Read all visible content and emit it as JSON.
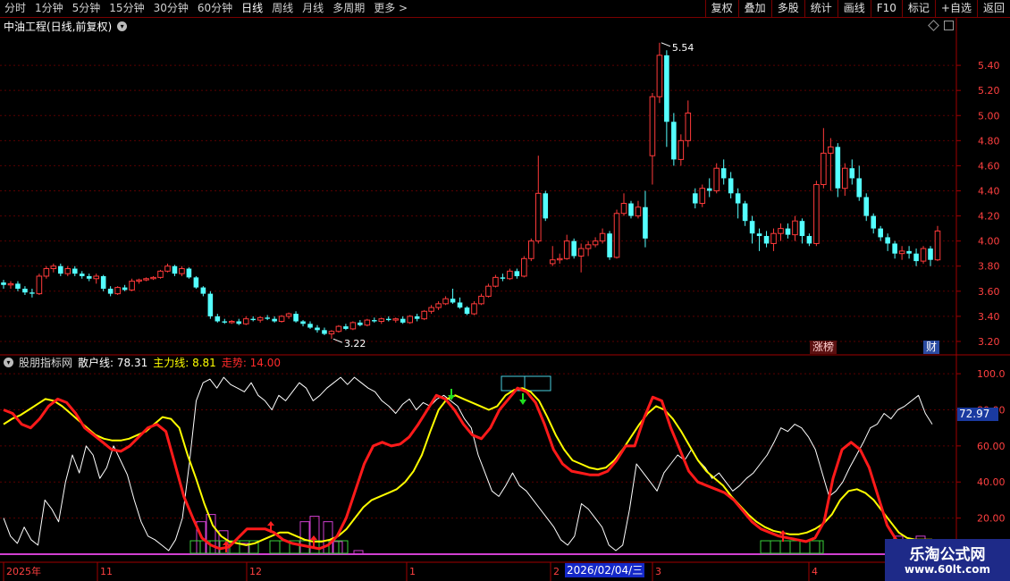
{
  "toolbar": {
    "periods": [
      "分时",
      "1分钟",
      "5分钟",
      "15分钟",
      "30分钟",
      "60分钟",
      "日线",
      "周线",
      "月线",
      "多周期",
      "更多 >"
    ],
    "active_period": "日线",
    "buttons": [
      "复权",
      "叠加",
      "多股",
      "统计",
      "画线",
      "F10",
      "标记",
      "+自选",
      "返回"
    ]
  },
  "header": {
    "stock": "中油工程(日线,前复权)"
  },
  "indicator": {
    "name": "股朋指标网",
    "retail": "散户线: 78.31",
    "main": "主力线: 8.81",
    "trend": "走势: 14.00",
    "current_value": "72.97"
  },
  "badges": {
    "zb": "涨榜",
    "cai": "财"
  },
  "date_box": "2026/02/04/三",
  "watermark": {
    "title": "乐淘公式网",
    "url": "www.60lt.com"
  },
  "colors": {
    "up": "#ff3a3a",
    "down": "#54ffff",
    "yellow": "#ffff00",
    "red_line": "#ff1a1a",
    "magenta": "#d040d0",
    "green": "#3ad23a",
    "grid": "#5a0000"
  },
  "chart_data": [
    {
      "type": "candlestick",
      "title": "中油工程(日线,前复权)",
      "ylim": [
        3.1,
        5.65
      ],
      "y_ticks": [
        "5.40",
        "5.20",
        "5.00",
        "4.80",
        "4.60",
        "4.40",
        "4.20",
        "4.00",
        "3.80",
        "3.60",
        "3.40",
        "3.20"
      ],
      "x_ticks": [
        "2025年",
        "11",
        "12",
        "1",
        "2",
        "3",
        "4"
      ],
      "annotations": {
        "high": "5.54",
        "low": "3.22"
      },
      "ohlc": [
        [
          3.67,
          3.69,
          3.62,
          3.65
        ],
        [
          3.65,
          3.68,
          3.62,
          3.66
        ],
        [
          3.66,
          3.68,
          3.6,
          3.62
        ],
        [
          3.62,
          3.64,
          3.57,
          3.59
        ],
        [
          3.59,
          3.62,
          3.55,
          3.58
        ],
        [
          3.58,
          3.74,
          3.57,
          3.72
        ],
        [
          3.72,
          3.8,
          3.7,
          3.78
        ],
        [
          3.78,
          3.82,
          3.75,
          3.8
        ],
        [
          3.8,
          3.82,
          3.72,
          3.74
        ],
        [
          3.74,
          3.8,
          3.72,
          3.78
        ],
        [
          3.78,
          3.8,
          3.72,
          3.74
        ],
        [
          3.74,
          3.76,
          3.7,
          3.72
        ],
        [
          3.72,
          3.74,
          3.68,
          3.7
        ],
        [
          3.7,
          3.74,
          3.66,
          3.72
        ],
        [
          3.72,
          3.73,
          3.6,
          3.62
        ],
        [
          3.62,
          3.64,
          3.56,
          3.58
        ],
        [
          3.58,
          3.64,
          3.57,
          3.63
        ],
        [
          3.63,
          3.65,
          3.6,
          3.61
        ],
        [
          3.61,
          3.7,
          3.6,
          3.68
        ],
        [
          3.68,
          3.7,
          3.66,
          3.69
        ],
        [
          3.69,
          3.71,
          3.68,
          3.7
        ],
        [
          3.7,
          3.72,
          3.69,
          3.71
        ],
        [
          3.71,
          3.77,
          3.7,
          3.76
        ],
        [
          3.76,
          3.82,
          3.75,
          3.8
        ],
        [
          3.8,
          3.81,
          3.72,
          3.74
        ],
        [
          3.74,
          3.8,
          3.72,
          3.78
        ],
        [
          3.78,
          3.79,
          3.7,
          3.71
        ],
        [
          3.71,
          3.72,
          3.62,
          3.63
        ],
        [
          3.63,
          3.64,
          3.56,
          3.58
        ],
        [
          3.58,
          3.6,
          3.38,
          3.4
        ],
        [
          3.4,
          3.42,
          3.35,
          3.36
        ],
        [
          3.36,
          3.38,
          3.34,
          3.35
        ],
        [
          3.35,
          3.37,
          3.34,
          3.36
        ],
        [
          3.36,
          3.38,
          3.33,
          3.34
        ],
        [
          3.34,
          3.4,
          3.33,
          3.38
        ],
        [
          3.38,
          3.4,
          3.36,
          3.37
        ],
        [
          3.37,
          3.4,
          3.35,
          3.39
        ],
        [
          3.39,
          3.41,
          3.37,
          3.38
        ],
        [
          3.38,
          3.4,
          3.35,
          3.36
        ],
        [
          3.36,
          3.41,
          3.35,
          3.4
        ],
        [
          3.4,
          3.43,
          3.38,
          3.42
        ],
        [
          3.42,
          3.44,
          3.35,
          3.36
        ],
        [
          3.36,
          3.37,
          3.32,
          3.34
        ],
        [
          3.34,
          3.36,
          3.3,
          3.31
        ],
        [
          3.31,
          3.33,
          3.27,
          3.29
        ],
        [
          3.29,
          3.31,
          3.25,
          3.26
        ],
        [
          3.26,
          3.29,
          3.22,
          3.28
        ],
        [
          3.28,
          3.33,
          3.27,
          3.32
        ],
        [
          3.32,
          3.34,
          3.29,
          3.3
        ],
        [
          3.3,
          3.36,
          3.29,
          3.35
        ],
        [
          3.35,
          3.37,
          3.32,
          3.33
        ],
        [
          3.33,
          3.38,
          3.32,
          3.37
        ],
        [
          3.37,
          3.39,
          3.35,
          3.36
        ],
        [
          3.36,
          3.39,
          3.34,
          3.38
        ],
        [
          3.38,
          3.4,
          3.36,
          3.37
        ],
        [
          3.37,
          3.39,
          3.35,
          3.38
        ],
        [
          3.38,
          3.4,
          3.34,
          3.35
        ],
        [
          3.35,
          3.41,
          3.34,
          3.4
        ],
        [
          3.4,
          3.42,
          3.36,
          3.38
        ],
        [
          3.38,
          3.45,
          3.37,
          3.44
        ],
        [
          3.44,
          3.49,
          3.42,
          3.47
        ],
        [
          3.47,
          3.52,
          3.45,
          3.5
        ],
        [
          3.5,
          3.56,
          3.49,
          3.54
        ],
        [
          3.54,
          3.62,
          3.5,
          3.51
        ],
        [
          3.51,
          3.55,
          3.46,
          3.47
        ],
        [
          3.47,
          3.48,
          3.41,
          3.42
        ],
        [
          3.42,
          3.52,
          3.41,
          3.5
        ],
        [
          3.5,
          3.58,
          3.49,
          3.56
        ],
        [
          3.56,
          3.66,
          3.55,
          3.64
        ],
        [
          3.64,
          3.73,
          3.63,
          3.71
        ],
        [
          3.71,
          3.74,
          3.68,
          3.7
        ],
        [
          3.7,
          3.78,
          3.69,
          3.76
        ],
        [
          3.76,
          3.78,
          3.7,
          3.72
        ],
        [
          3.72,
          3.88,
          3.71,
          3.86
        ],
        [
          3.86,
          4.02,
          3.84,
          4.0
        ],
        [
          4.0,
          4.68,
          3.98,
          4.38
        ],
        [
          4.38,
          4.4,
          4.16,
          4.18
        ],
        [
          3.82,
          3.96,
          3.8,
          3.85
        ],
        [
          3.85,
          3.9,
          3.82,
          3.86
        ],
        [
          3.86,
          4.05,
          3.85,
          4.0
        ],
        [
          4.0,
          4.02,
          3.86,
          3.88
        ],
        [
          3.88,
          3.98,
          3.75,
          3.94
        ],
        [
          3.94,
          4.0,
          3.88,
          3.97
        ],
        [
          3.97,
          4.03,
          3.95,
          4.0
        ],
        [
          4.0,
          4.1,
          3.98,
          4.06
        ],
        [
          4.06,
          4.08,
          3.85,
          3.87
        ],
        [
          3.87,
          4.25,
          3.86,
          4.22
        ],
        [
          4.22,
          4.38,
          4.2,
          4.3
        ],
        [
          4.3,
          4.32,
          4.18,
          4.2
        ],
        [
          4.2,
          4.32,
          4.18,
          4.27
        ],
        [
          4.27,
          4.4,
          3.95,
          4.02
        ],
        [
          4.68,
          5.18,
          4.45,
          5.15
        ],
        [
          5.15,
          5.58,
          5.1,
          5.48
        ],
        [
          5.48,
          5.52,
          4.75,
          4.95
        ],
        [
          4.95,
          5.02,
          4.6,
          4.65
        ],
        [
          4.65,
          4.85,
          4.6,
          4.8
        ],
        [
          4.8,
          5.12,
          4.75,
          5.02
        ],
        [
          4.38,
          4.42,
          4.26,
          4.3
        ],
        [
          4.3,
          4.45,
          4.27,
          4.42
        ],
        [
          4.42,
          4.5,
          4.35,
          4.4
        ],
        [
          4.4,
          4.62,
          4.38,
          4.58
        ],
        [
          4.58,
          4.65,
          4.45,
          4.5
        ],
        [
          4.5,
          4.55,
          4.34,
          4.38
        ],
        [
          4.38,
          4.42,
          4.18,
          4.3
        ],
        [
          4.3,
          4.32,
          4.12,
          4.16
        ],
        [
          4.16,
          4.2,
          3.98,
          4.06
        ],
        [
          4.06,
          4.1,
          3.92,
          4.04
        ],
        [
          4.04,
          4.08,
          3.95,
          3.98
        ],
        [
          3.98,
          4.1,
          3.92,
          4.06
        ],
        [
          4.06,
          4.14,
          4.0,
          4.1
        ],
        [
          4.1,
          4.14,
          4.02,
          4.05
        ],
        [
          4.05,
          4.2,
          4.0,
          4.16
        ],
        [
          4.16,
          4.18,
          3.98,
          4.04
        ],
        [
          4.04,
          4.06,
          3.96,
          3.98
        ],
        [
          3.98,
          4.48,
          3.96,
          4.45
        ],
        [
          4.45,
          4.9,
          4.42,
          4.7
        ],
        [
          4.7,
          4.82,
          4.4,
          4.75
        ],
        [
          4.75,
          4.78,
          4.35,
          4.42
        ],
        [
          4.42,
          4.62,
          4.36,
          4.58
        ],
        [
          4.58,
          4.65,
          4.45,
          4.5
        ],
        [
          4.5,
          4.6,
          4.32,
          4.35
        ],
        [
          4.35,
          4.38,
          4.16,
          4.2
        ],
        [
          4.2,
          4.22,
          4.06,
          4.1
        ],
        [
          4.1,
          4.12,
          4.0,
          4.03
        ],
        [
          4.03,
          4.06,
          3.92,
          3.98
        ],
        [
          3.98,
          4.0,
          3.86,
          3.9
        ],
        [
          3.9,
          3.96,
          3.85,
          3.92
        ],
        [
          3.92,
          3.96,
          3.86,
          3.9
        ],
        [
          3.9,
          3.94,
          3.8,
          3.84
        ],
        [
          3.84,
          3.96,
          3.82,
          3.94
        ],
        [
          3.94,
          3.96,
          3.8,
          3.85
        ],
        [
          3.85,
          4.12,
          3.84,
          4.08
        ]
      ]
    },
    {
      "type": "line",
      "title": "股朋指标网",
      "ylim": [
        0,
        105
      ],
      "y_ticks": [
        "100.0",
        "80.00",
        "60.00",
        "40.00",
        "20.00"
      ],
      "series": [
        {
          "name": "散户线",
          "color": "#ffffff",
          "values": [
            20,
            10,
            6,
            15,
            8,
            5,
            30,
            25,
            18,
            40,
            55,
            45,
            60,
            55,
            42,
            48,
            60,
            52,
            44,
            30,
            18,
            10,
            8,
            5,
            2,
            8,
            20,
            50,
            85,
            95,
            97,
            92,
            98,
            94,
            92,
            90,
            95,
            88,
            85,
            80,
            88,
            85,
            90,
            95,
            92,
            85,
            88,
            92,
            95,
            98,
            94,
            98,
            95,
            92,
            90,
            85,
            82,
            78,
            83,
            86,
            80,
            84,
            82,
            86,
            88,
            85,
            82,
            75,
            70,
            55,
            45,
            35,
            32,
            38,
            45,
            38,
            35,
            30,
            25,
            20,
            15,
            8,
            5,
            10,
            28,
            25,
            20,
            15,
            5,
            2,
            5,
            25,
            50,
            45,
            40,
            35,
            45,
            50,
            55,
            52,
            58,
            52,
            48,
            42,
            45,
            40,
            35,
            38,
            42,
            45,
            50,
            55,
            62,
            70,
            68,
            72,
            70,
            65,
            58,
            45,
            32,
            35,
            40,
            48,
            55,
            62,
            70,
            72,
            78,
            75,
            80,
            82,
            85,
            88,
            78,
            72
          ]
        },
        {
          "name": "主力线",
          "color": "#ffff00",
          "values": [
            72,
            75,
            77,
            80,
            83,
            86,
            85,
            82,
            78,
            74,
            70,
            66,
            64,
            63,
            63,
            64,
            66,
            68,
            72,
            76,
            75,
            70,
            55,
            42,
            28,
            16,
            10,
            7,
            6,
            5,
            6,
            8,
            10,
            12,
            12,
            10,
            8,
            7,
            7,
            8,
            10,
            14,
            20,
            26,
            30,
            32,
            34,
            36,
            40,
            46,
            55,
            68,
            80,
            86,
            88,
            86,
            84,
            82,
            80,
            82,
            88,
            91,
            92,
            90,
            85,
            76,
            66,
            58,
            52,
            50,
            48,
            47,
            48,
            52,
            58,
            65,
            72,
            78,
            82,
            80,
            75,
            68,
            60,
            52,
            46,
            42,
            38,
            32,
            27,
            22,
            18,
            15,
            13,
            12,
            11,
            11,
            12,
            14,
            17,
            22,
            30,
            35,
            36,
            34,
            30,
            24,
            18,
            12,
            9,
            8,
            8,
            8
          ]
        },
        {
          "name": "走势",
          "color": "#ff1a1a",
          "values": [
            80,
            78,
            72,
            70,
            75,
            82,
            86,
            84,
            78,
            70,
            66,
            62,
            58,
            57,
            60,
            65,
            70,
            72,
            68,
            50,
            32,
            20,
            9,
            5,
            3,
            4,
            9,
            14,
            14,
            14,
            12,
            8,
            6,
            5,
            4,
            3,
            5,
            10,
            20,
            35,
            50,
            60,
            62,
            60,
            61,
            65,
            72,
            80,
            88,
            86,
            80,
            72,
            66,
            64,
            70,
            80,
            86,
            92,
            90,
            84,
            72,
            58,
            50,
            46,
            45,
            44,
            44,
            46,
            52,
            60,
            60,
            75,
            87,
            85,
            70,
            58,
            46,
            40,
            38,
            36,
            34,
            30,
            24,
            18,
            14,
            12,
            10,
            9,
            8,
            7,
            9,
            18,
            42,
            58,
            62,
            58,
            48,
            32,
            16,
            8,
            5,
            4,
            4,
            6
          ]
        }
      ]
    }
  ]
}
